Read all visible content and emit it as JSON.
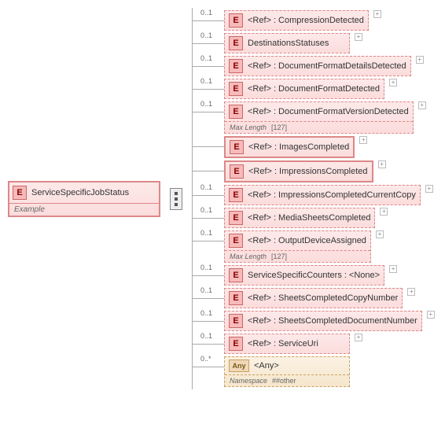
{
  "root": {
    "badge": "E",
    "name": "ServiceSpecificJobStatus",
    "footer": "Example"
  },
  "children": [
    {
      "occ": "0..1",
      "badge": "E",
      "ref": "<Ref>",
      "name": "CompressionDetected",
      "dashed": true,
      "expand": true
    },
    {
      "occ": "0..1",
      "badge": "E",
      "ref": null,
      "name": "DestinationsStatuses",
      "dashed": true,
      "expand": true
    },
    {
      "occ": "0..1",
      "badge": "E",
      "ref": "<Ref>",
      "name": "DocumentFormatDetailsDetected",
      "dashed": true,
      "expand": true
    },
    {
      "occ": "0..1",
      "badge": "E",
      "ref": "<Ref>",
      "name": "DocumentFormatDetected",
      "dashed": true,
      "expand": true
    },
    {
      "occ": "0..1",
      "badge": "E",
      "ref": "<Ref>",
      "name": "DocumentFormatVersionDetected",
      "dashed": true,
      "expand": true,
      "footerLabel": "Max Length",
      "footerValue": "[127]"
    },
    {
      "occ": "",
      "badge": "E",
      "ref": "<Ref>",
      "name": "ImagesCompleted",
      "dashed": false,
      "expand": true
    },
    {
      "occ": "",
      "badge": "E",
      "ref": "<Ref>",
      "name": "ImpressionsCompleted",
      "dashed": false,
      "expand": true
    },
    {
      "occ": "0..1",
      "badge": "E",
      "ref": "<Ref>",
      "name": "ImpressionsCompletedCurrentCopy",
      "dashed": true,
      "expand": true
    },
    {
      "occ": "0..1",
      "badge": "E",
      "ref": "<Ref>",
      "name": "MediaSheetsCompleted",
      "dashed": true,
      "expand": true
    },
    {
      "occ": "0..1",
      "badge": "E",
      "ref": "<Ref>",
      "name": "OutputDeviceAssigned",
      "dashed": true,
      "expand": true,
      "footerLabel": "Max Length",
      "footerValue": "[127]"
    },
    {
      "occ": "0..1",
      "badge": "E",
      "ref": null,
      "name": "ServiceSpecificCounters",
      "suffix": "<None>",
      "dashed": true,
      "expand": true
    },
    {
      "occ": "0..1",
      "badge": "E",
      "ref": "<Ref>",
      "name": "SheetsCompletedCopyNumber",
      "dashed": true,
      "expand": true
    },
    {
      "occ": "0..1",
      "badge": "E",
      "ref": "<Ref>",
      "name": "SheetsCompletedDocumentNumber",
      "dashed": true,
      "expand": true
    },
    {
      "occ": "0..1",
      "badge": "E",
      "ref": "<Ref>",
      "name": "ServiceUri",
      "dashed": true,
      "expand": true
    },
    {
      "occ": "0..*",
      "badge": "Any",
      "ref": null,
      "name": "<Any>",
      "dashed": true,
      "expand": false,
      "any": true,
      "footerLabel": "Namespace",
      "footerValue": "##other"
    }
  ]
}
